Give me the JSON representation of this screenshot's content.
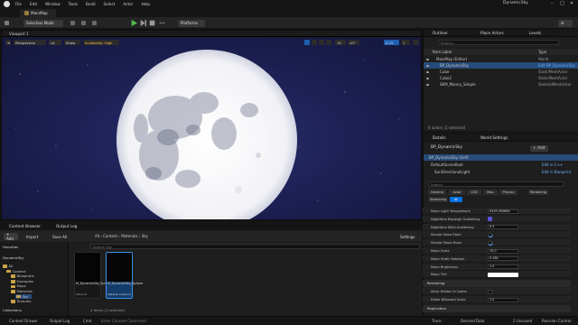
{
  "menubar": {
    "items": [
      "File",
      "Edit",
      "Window",
      "Tools",
      "Build",
      "Select",
      "Actor",
      "Help"
    ],
    "title": "DynamicSky",
    "window_controls": [
      "–",
      "□",
      "✕"
    ]
  },
  "doc_tab": {
    "label": "MainMap"
  },
  "toolbar": {
    "mode": "Selection Mode",
    "platforms": "Platforms"
  },
  "viewport": {
    "tab": "Viewport 1",
    "perspective": "Perspective",
    "lit": "Lit",
    "show": "Show",
    "scalability": "Scalability: High",
    "grid_snap": "10",
    "rot_snap": "10°",
    "scale_snap": "0.25",
    "cam_speed": "1"
  },
  "outliner": {
    "tab": "Outliner",
    "tab2": "Place Actors",
    "tab3": "Levels",
    "search_placeholder": "Search...",
    "col_label": "Item Label",
    "col_type": "Type",
    "rows": [
      {
        "label": "MainMap (Editor)",
        "type": "World",
        "link": false,
        "sel": false,
        "indent": 6
      },
      {
        "label": "BP_DynamicSky",
        "type": "Edit BP_DynamicSky",
        "link": true,
        "sel": true,
        "indent": 10
      },
      {
        "label": "Cube",
        "type": "StaticMeshActor",
        "link": false,
        "sel": false,
        "indent": 10
      },
      {
        "label": "Cube2",
        "type": "StaticMeshActor",
        "link": false,
        "sel": false,
        "indent": 10
      },
      {
        "label": "SKM_Manny_Simple",
        "type": "SkeletalMeshActor",
        "link": false,
        "sel": false,
        "indent": 10
      }
    ],
    "footer": "4 actors (1 selected)"
  },
  "details": {
    "tab": "Details",
    "tab2": "World Settings",
    "actor": "BP_DynamicSky",
    "add": "+ Add",
    "components": [
      {
        "label": "BP_DynamicSky (Self)",
        "action": "",
        "sel": true,
        "indent": 6
      },
      {
        "label": "DefaultSceneRoot",
        "action": "Edit in C++",
        "sel": false,
        "indent": 8
      },
      {
        "label": "SunDirectionalLight",
        "action": "Edit in Blueprint",
        "sel": false,
        "indent": 12
      }
    ],
    "search_placeholder": "Search",
    "categories": [
      "General",
      "Actor",
      "LOD",
      "Misc",
      "Physics",
      "Rendering",
      "Streaming",
      "All"
    ],
    "props": [
      {
        "label": "Moon Light Temperature",
        "value": "5435.450684",
        "kind": "val"
      },
      {
        "label": "Nighttime Rayleigh Scattering",
        "value": "",
        "kind": "swatch"
      },
      {
        "label": "Nighttime Multi-Scattering",
        "value": "0.5",
        "kind": "val"
      },
      {
        "label": "Should Show Stars",
        "value": "",
        "kind": "check_on"
      },
      {
        "label": "Should Show Moon",
        "value": "",
        "kind": "check_on"
      },
      {
        "label": "Moon Scale",
        "value": "10.0",
        "kind": "val"
      },
      {
        "label": "Moon Static Rotation",
        "value": "0.184",
        "kind": "val"
      },
      {
        "label": "Moon Brightness",
        "value": "1.0",
        "kind": "val"
      },
      {
        "label": "Moon Tint",
        "value": "",
        "kind": "white"
      }
    ],
    "section_rendering": "Rendering",
    "props2": [
      {
        "label": "Actor Hidden In Game",
        "value": "",
        "kind": "check_off"
      },
      {
        "label": "Editor Billboard Scale",
        "value": "1.0",
        "kind": "val"
      }
    ],
    "section_replication": "Replication"
  },
  "content_browser": {
    "tab": "Content Browser",
    "tab2": "Output Log",
    "add": "+ Add",
    "import": "Import",
    "save_all": "Save All",
    "path": [
      "All",
      "Content",
      "Materials",
      "Sky"
    ],
    "settings": "Settings",
    "favorites": "Favorites",
    "project": "DynamicSky",
    "search_placeholder": "Search Sky",
    "tree": [
      {
        "label": "All",
        "indent": 3
      },
      {
        "label": "Content",
        "indent": 7
      },
      {
        "label": "Blueprints",
        "indent": 12
      },
      {
        "label": "Examples",
        "indent": 12
      },
      {
        "label": "Maps",
        "indent": 12
      },
      {
        "label": "Materials",
        "indent": 12
      },
      {
        "label": "Sky",
        "indent": 17
      },
      {
        "label": "Textures",
        "indent": 12
      }
    ],
    "collections": "Collections",
    "assets": [
      {
        "name": "M_DynamicSky_Sphere",
        "type": "Material",
        "sel": false
      },
      {
        "name": "M_DynamicSky_Sphere",
        "type": "Material Instance",
        "sel": true
      }
    ],
    "footer": "2 items (1 selected)"
  },
  "statusbar": {
    "drawer": "Content Drawer",
    "output": "Output Log",
    "cmd": "Cmd",
    "console_placeholder": "Enter Console Command",
    "trace": "Trace",
    "derived": "Derived Data",
    "unsaved": "2 Unsaved",
    "revision": "Revision Control"
  },
  "colors": {
    "accent": "#0070e0",
    "selection": "#274b7a",
    "link": "#6fb2ff",
    "folder": "#c9a24a"
  },
  "icons": [
    "unreal-logo-icon",
    "play-icon",
    "search-icon",
    "folder-icon",
    "gear-icon",
    "eye-icon"
  ]
}
